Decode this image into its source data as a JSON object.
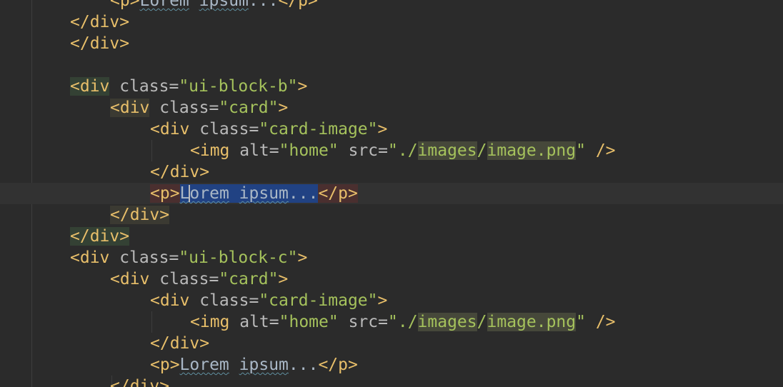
{
  "editor": {
    "lines": [
      {
        "parts": [
          {
            "t": "<p>",
            "c": "tag"
          },
          {
            "t": "Lorem",
            "c": "txt squig"
          },
          {
            "t": " ",
            "c": "txt"
          },
          {
            "t": "ipsum",
            "c": "txt squig"
          },
          {
            "t": "...",
            "c": "txt"
          },
          {
            "t": "</p>",
            "c": "tag"
          }
        ]
      },
      {
        "parts": [
          {
            "t": "</div>",
            "c": "tag"
          }
        ]
      },
      {
        "parts": [
          {
            "t": "</div>",
            "c": "tag"
          }
        ]
      },
      {
        "parts": []
      },
      {
        "parts": [
          {
            "t": "<div",
            "c": "tag match-g"
          },
          {
            "t": " class=",
            "c": "attr"
          },
          {
            "t": "\"ui-block-b\"",
            "c": "str"
          },
          {
            "t": ">",
            "c": "tag"
          }
        ]
      },
      {
        "parts": [
          {
            "t": "<div",
            "c": "tag match-y"
          },
          {
            "t": " class=",
            "c": "attr"
          },
          {
            "t": "\"card\"",
            "c": "str"
          },
          {
            "t": ">",
            "c": "tag"
          }
        ]
      },
      {
        "parts": [
          {
            "t": "<div",
            "c": "tag"
          },
          {
            "t": " class=",
            "c": "attr"
          },
          {
            "t": "\"card-image\"",
            "c": "str"
          },
          {
            "t": ">",
            "c": "tag"
          }
        ]
      },
      {
        "parts": [
          {
            "t": "<img",
            "c": "tag"
          },
          {
            "t": " alt=",
            "c": "attr"
          },
          {
            "t": "\"home\"",
            "c": "str"
          },
          {
            "t": " src=",
            "c": "attr"
          },
          {
            "t": "\".",
            "c": "str"
          },
          {
            "t": "/",
            "c": "str"
          },
          {
            "t": "images",
            "c": "str pathhl"
          },
          {
            "t": "/",
            "c": "str"
          },
          {
            "t": "image.png",
            "c": "str pathhl"
          },
          {
            "t": "\"",
            "c": "str"
          },
          {
            "t": " />",
            "c": "tag"
          }
        ]
      },
      {
        "parts": [
          {
            "t": "</div>",
            "c": "tag"
          }
        ]
      },
      {
        "parts": [
          {
            "t": "<p>",
            "c": "tag match-r"
          },
          {
            "t": "L",
            "c": "txt sel squig"
          },
          {
            "t": "|",
            "c": "caret"
          },
          {
            "t": "orem",
            "c": "txt sel squig"
          },
          {
            "t": " ",
            "c": "txt sel"
          },
          {
            "t": "ipsum",
            "c": "txt sel squig"
          },
          {
            "t": "...",
            "c": "txt sel"
          },
          {
            "t": "</p>",
            "c": "tag match-r"
          }
        ]
      },
      {
        "parts": [
          {
            "t": "</div>",
            "c": "tag match-y"
          }
        ]
      },
      {
        "parts": [
          {
            "t": "</div>",
            "c": "tag match-g"
          }
        ]
      },
      {
        "parts": [
          {
            "t": "<div",
            "c": "tag"
          },
          {
            "t": " class=",
            "c": "attr"
          },
          {
            "t": "\"ui-block-c\"",
            "c": "str"
          },
          {
            "t": ">",
            "c": "tag"
          }
        ]
      },
      {
        "parts": [
          {
            "t": "<div",
            "c": "tag"
          },
          {
            "t": " class=",
            "c": "attr"
          },
          {
            "t": "\"card\"",
            "c": "str"
          },
          {
            "t": ">",
            "c": "tag"
          }
        ]
      },
      {
        "parts": [
          {
            "t": "<div",
            "c": "tag"
          },
          {
            "t": " class=",
            "c": "attr"
          },
          {
            "t": "\"card-image\"",
            "c": "str"
          },
          {
            "t": ">",
            "c": "tag"
          }
        ]
      },
      {
        "parts": [
          {
            "t": "<img",
            "c": "tag"
          },
          {
            "t": " alt=",
            "c": "attr"
          },
          {
            "t": "\"home\"",
            "c": "str"
          },
          {
            "t": " src=",
            "c": "attr"
          },
          {
            "t": "\".",
            "c": "str"
          },
          {
            "t": "/",
            "c": "str"
          },
          {
            "t": "images",
            "c": "str pathhl"
          },
          {
            "t": "/",
            "c": "str"
          },
          {
            "t": "image.png",
            "c": "str pathhl"
          },
          {
            "t": "\"",
            "c": "str"
          },
          {
            "t": " />",
            "c": "tag"
          }
        ]
      },
      {
        "parts": [
          {
            "t": "</div>",
            "c": "tag"
          }
        ]
      },
      {
        "parts": [
          {
            "t": "<p>",
            "c": "tag"
          },
          {
            "t": "Lorem",
            "c": "txt squig"
          },
          {
            "t": " ",
            "c": "txt"
          },
          {
            "t": "ipsum",
            "c": "txt squig"
          },
          {
            "t": "...",
            "c": "txt"
          },
          {
            "t": "</p>",
            "c": "tag"
          }
        ]
      },
      {
        "parts": [
          {
            "t": "</div>",
            "c": "tag"
          }
        ]
      }
    ]
  },
  "colors": {
    "background": "#2b2b2b",
    "tag": "#e8bf6a",
    "attribute": "#bababa",
    "string": "#a5c25c",
    "selection": "#214283"
  }
}
